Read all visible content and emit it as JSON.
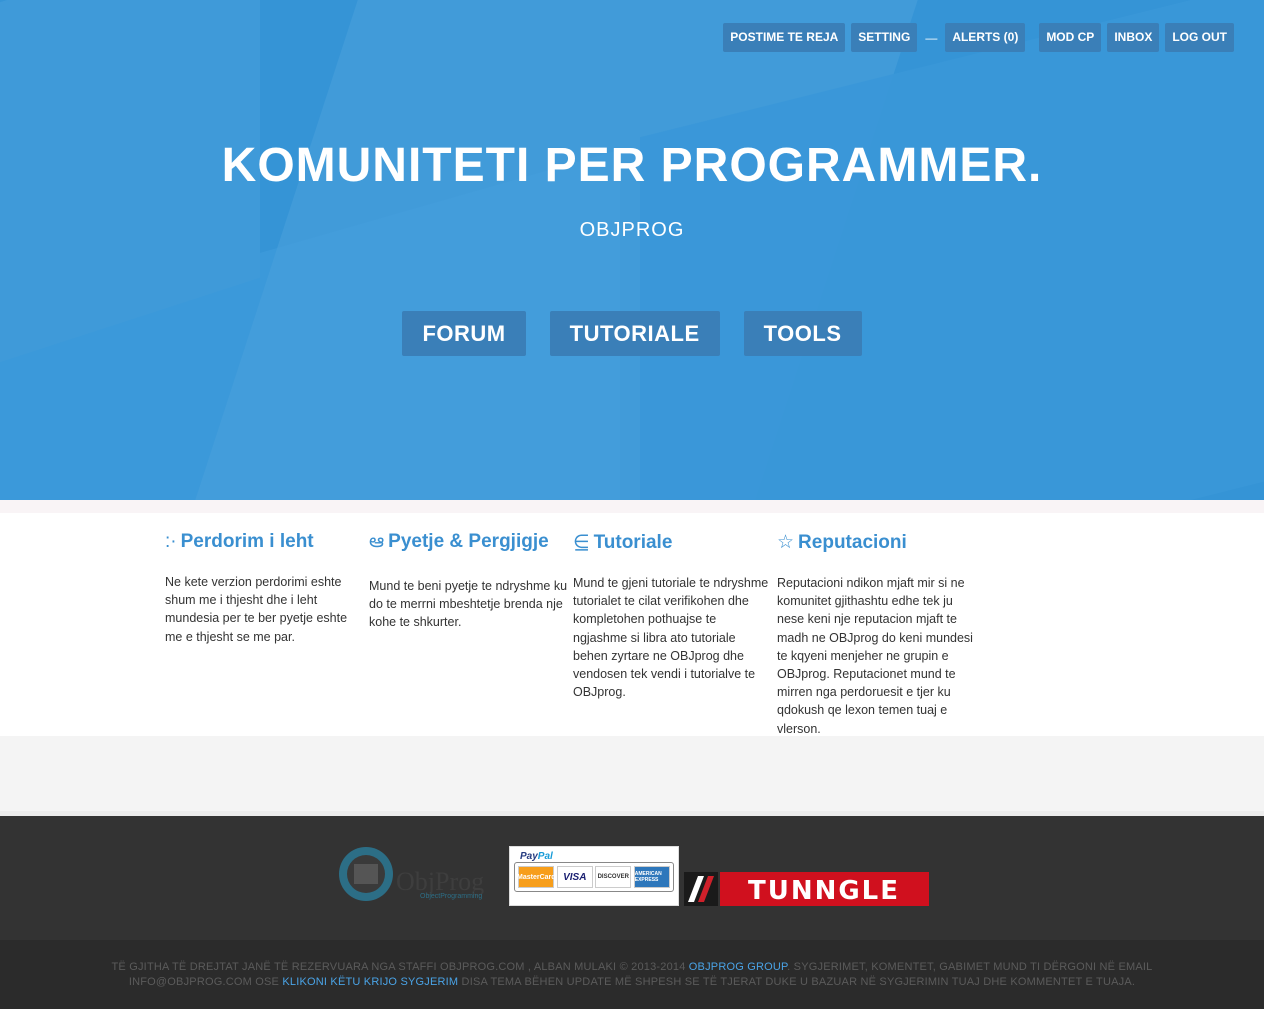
{
  "nav": {
    "new_posts": "POSTIME TE REJA",
    "setting": "SETTING",
    "separator": "—",
    "alerts": "ALERTS (0)",
    "mod_cp": "MOD CP",
    "inbox": "INBOX",
    "logout": "LOG OUT"
  },
  "hero": {
    "title": "KOMUNITETI PER PROGRAMMER.",
    "subtitle": "OBJPROG",
    "buttons": [
      "FORUM",
      "TUTORIALE",
      "TOOLS"
    ]
  },
  "features": [
    {
      "icon": ":·",
      "icon_name": "dots-icon",
      "title": "Perdorim i leht",
      "text": "Ne kete verzion perdorimi eshte shum me i thjesht dhe i leht mundesia per te ber pyetje eshte me e thjesht se me par."
    },
    {
      "icon": "ఆ",
      "icon_name": "chat-icon",
      "title": "Pyetje & Pergjigje",
      "text": "Mund te beni pyetje te ndryshme ku do te merrni mbeshtetje brenda nje kohe te shkurter."
    },
    {
      "icon": "⋸",
      "icon_name": "book-icon",
      "title": "Tutoriale",
      "text": "Mund te gjeni tutoriale te ndryshme tutorialet te cilat verifikohen dhe kompletohen pothuajse te ngjashme si libra ato tutoriale behen zyrtare ne OBJprog dhe vendosen tek vendi i tutorialve te OBJprog."
    },
    {
      "icon": "☆",
      "icon_name": "star-icon",
      "title": "Reputacioni",
      "text": "Reputacioni ndikon mjaft mir si ne komunitet gjithashtu edhe tek ju nese keni nje reputacion mjaft te madh ne OBJprog do keni mundesi te kqyeni menjeher ne grupin e OBJprog. Reputacionet mund te mirren nga perdoruesit e tjer ku qdokush qe lexon temen tuaj e vlerson."
    }
  ],
  "logos": {
    "objprog_main": "ObjProg",
    "objprog_small": "ObjectProgramming",
    "paypal_a": "Pay",
    "paypal_b": "Pal",
    "card_mc": "MasterCard",
    "card_visa": "VISA",
    "card_discover": "DISCOVER",
    "card_amex": "AMERICAN EXPRESS",
    "tunngle": "TUNNGLE"
  },
  "footer": {
    "part1": "TË GJITHA TË DREJTAT JANË TË REZERVUARA NGA STAFFI OBJPROG.COM , ALBAN MULAKI © 2013-2014",
    "link1": "OBJPROG GROUP",
    "part2": ". SYGJERIMET, KOMENTET, GABIMET MUND TI DËRGONI NË EMAIL INFO@OBJPROG.COM OSE",
    "link2": "KLIKONI KËTU KRIJO SYGJERIM",
    "part3": "DISA TEMA BËHEN UPDATE MË SHPESH SE TË TJERAT DUKE U BAZUAR NË SYGJERIMIN TUAJ DHE KOMMENTET E TUAJA."
  },
  "colors": {
    "hero_bg": "#3594d6",
    "button_bg": "#3a7fb8",
    "accent": "#3a8fd0",
    "footer_bg": "#2b2b2b"
  }
}
